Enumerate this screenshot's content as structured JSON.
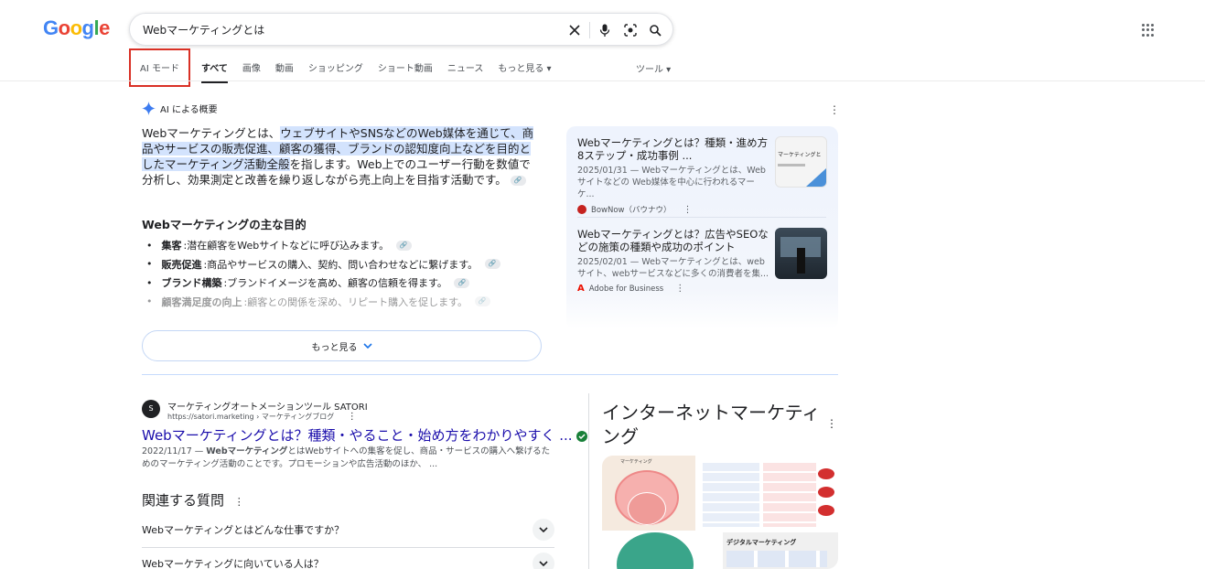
{
  "logo": {
    "letters": [
      "G",
      "o",
      "o",
      "g",
      "l",
      "e"
    ],
    "colors": [
      "#4285f4",
      "#ea4335",
      "#fbbc05",
      "#4285f4",
      "#34a853",
      "#ea4335"
    ]
  },
  "search": {
    "query": "Webマーケティングとは"
  },
  "tabs": [
    {
      "label": "AI モード"
    },
    {
      "label": "すべて"
    },
    {
      "label": "画像"
    },
    {
      "label": "動画"
    },
    {
      "label": "ショッピング"
    },
    {
      "label": "ショート動画"
    },
    {
      "label": "ニュース"
    },
    {
      "label": "もっと見る ▾"
    }
  ],
  "tools_label": "ツール ▾",
  "ai_overview": {
    "heading": "AI による概要",
    "para_pre": "Webマーケティングとは、",
    "para_hl": "ウェブサイトやSNSなどのWeb媒体を通じて、商品やサービスの販売促進、顧客の獲得、ブランドの認知度向上などを目的としたマーケティング活動全般",
    "para_post": "を指します。Web上でのユーザー行動を数値で分析し、効果測定と改善を繰り返しながら売上向上を目指す活動です。",
    "subheading": "Webマーケティングの主な目的",
    "items": [
      {
        "term": "集客",
        "text": ":潜在顧客をWebサイトなどに呼び込みます。"
      },
      {
        "term": "販売促進",
        "text": ":商品やサービスの購入、契約、問い合わせなどに繋げます。"
      },
      {
        "term": "ブランド構築",
        "text": ":ブランドイメージを高め、顧客の信頼を得ます。"
      },
      {
        "term": "顧客満足度の向上",
        "text": ":顧客との関係を深め、リピート購入を促します。"
      }
    ],
    "more_label": "もっと見る",
    "sources": [
      {
        "title": "Webマーケティングとは？種類・進め方8ステップ・成功事例 ...",
        "desc": "2025/01/31 — Webマーケティングとは、Webサイトなどの Web媒体を中心に行われるマーケ...",
        "site": "BowNow（バウナウ）"
      },
      {
        "title": "Webマーケティングとは？広告やSEOなどの施策の種類や成功のポイント",
        "desc": "2025/02/01 — Webマーケティングとは、webサイト、webサービスなどに多くの消費者を集...",
        "site": "Adobe for Business"
      }
    ],
    "source_thumb_text": "マーケティングと"
  },
  "result": {
    "site": "マーケティングオートメーションツール SATORI",
    "url": "https://satori.marketing › マーケティングブログ",
    "title": "Webマーケティングとは？種類・やること・始め方をわかりやすく ...",
    "date": "2022/11/17 — ",
    "snippet_bold": "Webマーケティング",
    "snippet": "とはWebサイトへの集客を促し、商品・サービスの購入へ繋げるためのマーケティング活動のことです。プロモーションや広告活動のほか、 ..."
  },
  "paa": {
    "title": "関連する質問",
    "questions": [
      "Webマーケティングとはどんな仕事ですか？",
      "Webマーケティングに向いている人は？"
    ]
  },
  "knowledge_panel": {
    "title": "インターネットマーケティング",
    "img1_label": "マーケティング",
    "img2_label": "デジタルマーケティング"
  }
}
